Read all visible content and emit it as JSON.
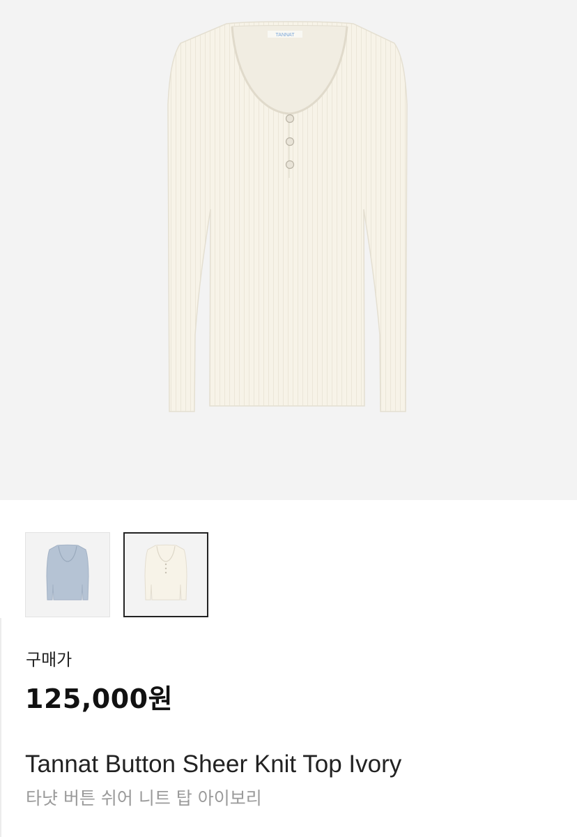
{
  "product": {
    "image_alt": "Tannat Button Sheer Knit Top Ivory",
    "colors": {
      "ivory": "#f7f3e8",
      "blue": "#b5c3d4",
      "background": "#f3f3f3",
      "selected_border": "#222222"
    },
    "thumbnails": [
      {
        "color_name": "blue",
        "selected": false
      },
      {
        "color_name": "ivory",
        "selected": true
      }
    ],
    "price_label": "구매가",
    "price": "125,000원",
    "title_en": "Tannat Button Sheer Knit Top Ivory",
    "title_ko": "타냣 버튼 쉬어 니트 탑 아이보리"
  }
}
